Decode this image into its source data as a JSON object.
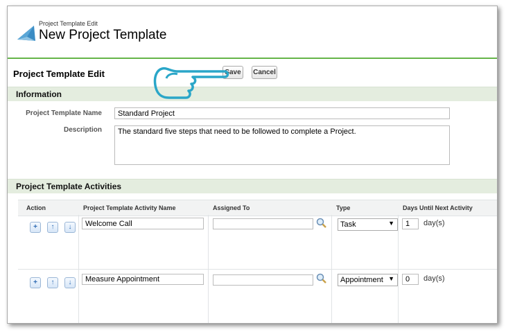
{
  "header": {
    "breadcrumb": "Project Template Edit",
    "title": "New Project Template"
  },
  "edit_block": {
    "title": "Project Template Edit",
    "save_label": "Save",
    "cancel_label": "Cancel"
  },
  "information": {
    "section_title": "Information",
    "name_label": "Project Template Name",
    "name_value": "Standard Project",
    "description_label": "Description",
    "description_value": "The standard five steps that need to be followed to complete a Project."
  },
  "activities": {
    "section_title": "Project Template Activities",
    "columns": [
      "Action",
      "Project Template Activity Name",
      "Assigned To",
      "Type",
      "Days Until Next Activity"
    ],
    "add_glyph": "+",
    "up_glyph": "↑",
    "down_glyph": "↓",
    "days_unit": "day(s)",
    "rows": [
      {
        "name": "Welcome Call",
        "assigned_to": "",
        "type": "Task",
        "days": "1"
      },
      {
        "name": "Measure Appointment",
        "assigned_to": "",
        "type": "Appointment",
        "days": "0"
      }
    ]
  },
  "icons": {
    "app_icon": "project-template-icon",
    "lookup_icon": "lookup-magnifier-icon",
    "pointer": "pointing-hand-icon"
  },
  "colors": {
    "accent_green": "#64b448",
    "section_bg": "#e4eddf",
    "hand_stroke": "#2aa6c8"
  }
}
